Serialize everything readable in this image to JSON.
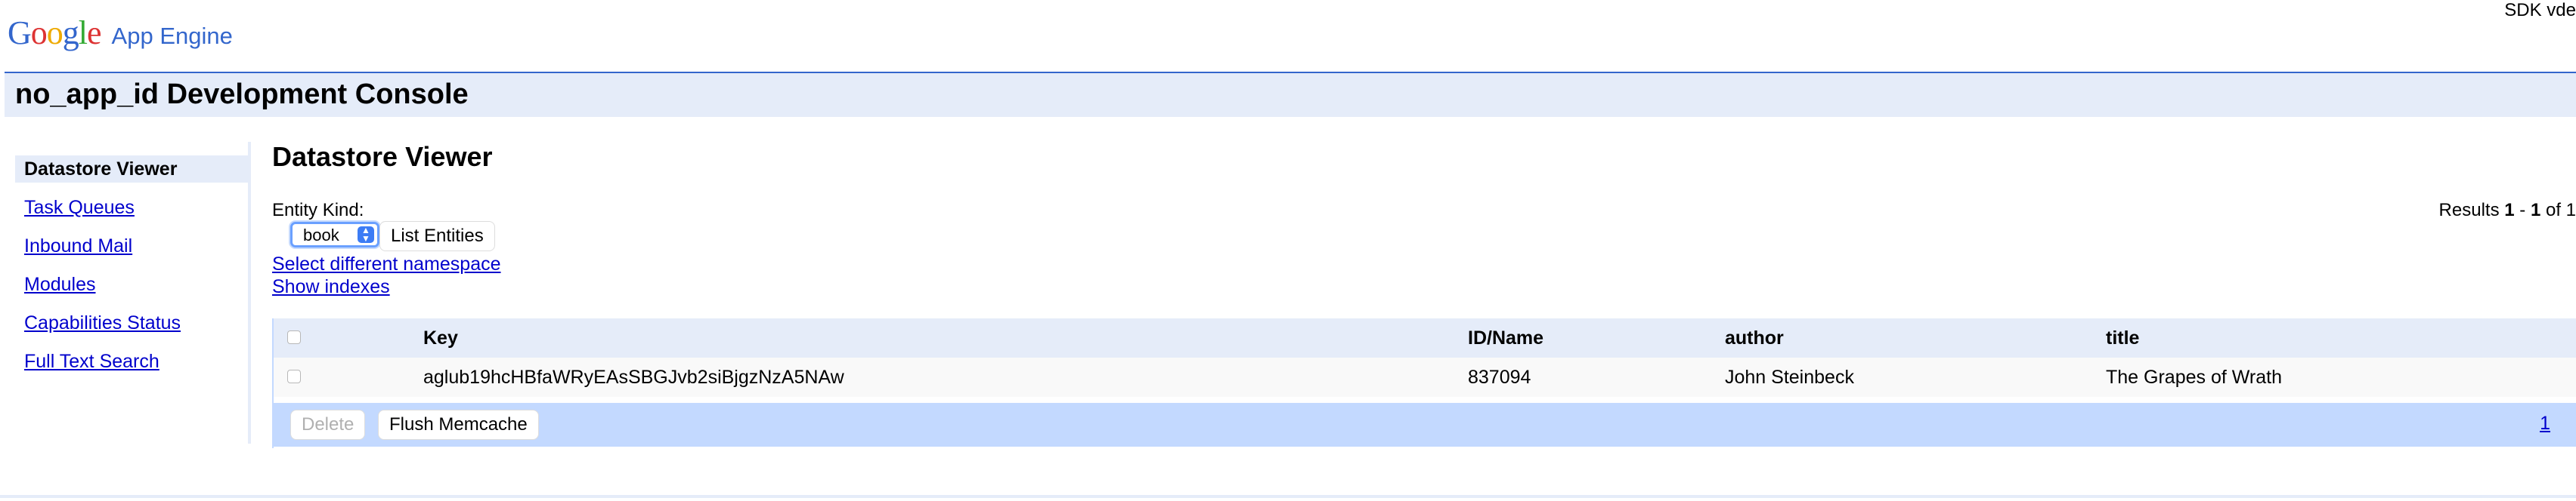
{
  "header": {
    "logo_letters": [
      {
        "ch": "G",
        "color": "#3366cc"
      },
      {
        "ch": "o",
        "color": "#dd3333"
      },
      {
        "ch": "o",
        "color": "#eeaa00"
      },
      {
        "ch": "g",
        "color": "#3366cc"
      },
      {
        "ch": "l",
        "color": "#33aa33"
      },
      {
        "ch": "e",
        "color": "#dd3333"
      }
    ],
    "logo_product": "App Engine",
    "sdk_version": "SDK vde"
  },
  "app_title": "no_app_id Development Console",
  "sidebar": {
    "items": [
      {
        "label": "Datastore Viewer",
        "selected": true
      },
      {
        "label": "Task Queues",
        "selected": false
      },
      {
        "label": "Inbound Mail",
        "selected": false
      },
      {
        "label": "Modules",
        "selected": false
      },
      {
        "label": "Capabilities Status",
        "selected": false
      },
      {
        "label": "Full Text Search",
        "selected": false
      }
    ]
  },
  "main": {
    "heading": "Datastore Viewer",
    "entity_kind_label": "Entity Kind:",
    "entity_kind_value": "book",
    "list_entities_label": "List Entities",
    "select_namespace_link": "Select different namespace",
    "show_indexes_link": "Show indexes",
    "results": {
      "prefix": "Results ",
      "start": "1",
      "sep": " - ",
      "end": "1",
      "suffix": " of 1"
    }
  },
  "table": {
    "columns": [
      "Key",
      "ID/Name",
      "author",
      "title"
    ],
    "rows": [
      {
        "key": "aglub19hcHBfaWRyEAsSBGJvb2siBjgzNzA5NAw",
        "id": "837094",
        "author": "John Steinbeck",
        "title": "The Grapes of Wrath"
      }
    ],
    "delete_label": "Delete",
    "flush_label": "Flush Memcache",
    "page_link": "1"
  },
  "colors": {
    "accent": "#3366cc",
    "header_bg": "#e5ecf9",
    "table_footer_bg": "#c3d9ff",
    "link": "#0000cc"
  }
}
